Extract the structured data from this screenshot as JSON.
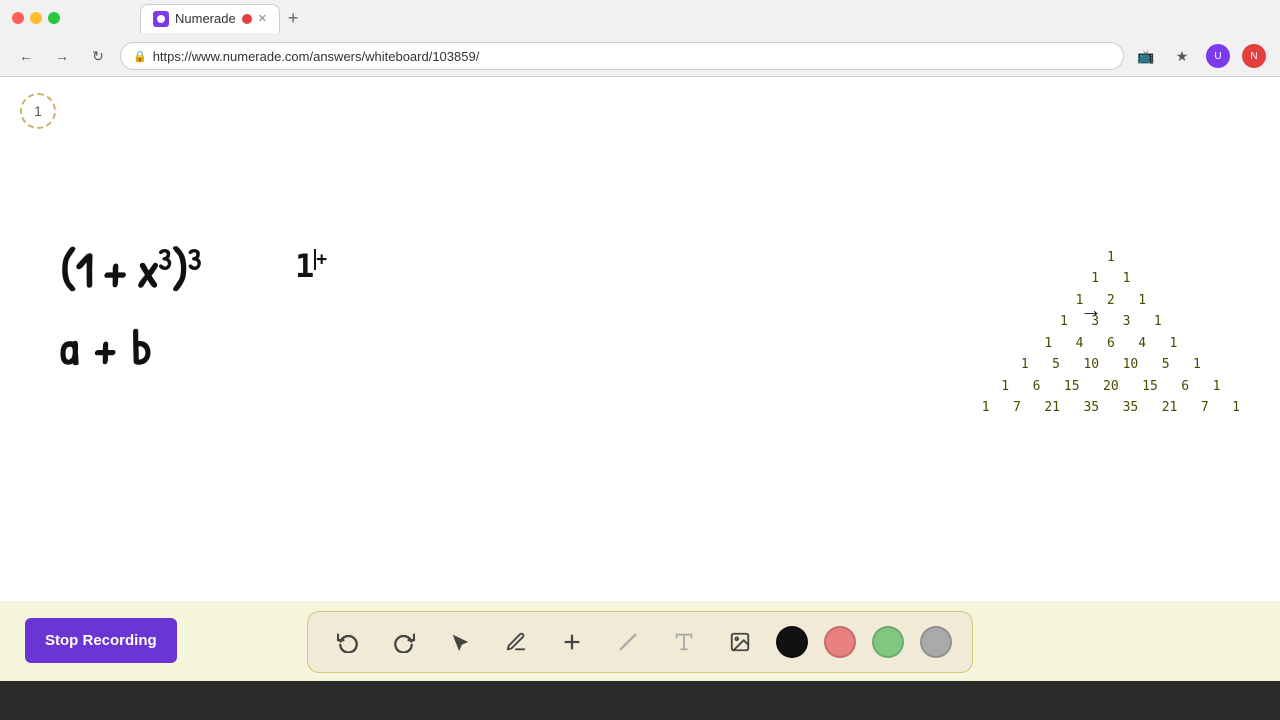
{
  "browser": {
    "traffic_lights": [
      "red",
      "yellow",
      "green"
    ],
    "tab": {
      "title": "Numerade",
      "url": "https://www.numerade.com/answers/whiteboard/103859/"
    },
    "nav_buttons": {
      "back": "←",
      "forward": "→",
      "refresh": "↻"
    }
  },
  "toolbar": {
    "stop_recording_label": "Stop Recording",
    "tools": [
      {
        "name": "undo",
        "icon": "↺"
      },
      {
        "name": "redo",
        "icon": "↻"
      },
      {
        "name": "select",
        "icon": "▲"
      },
      {
        "name": "pen",
        "icon": "✏"
      },
      {
        "name": "add",
        "icon": "+"
      },
      {
        "name": "eraser",
        "icon": "/"
      },
      {
        "name": "text",
        "icon": "A"
      },
      {
        "name": "image",
        "icon": "🖼"
      }
    ],
    "colors": [
      {
        "name": "black",
        "hex": "#111111"
      },
      {
        "name": "pink",
        "hex": "#e88080"
      },
      {
        "name": "green",
        "hex": "#80c880"
      },
      {
        "name": "gray",
        "hex": "#aaaaaa"
      }
    ]
  },
  "whiteboard": {
    "page_number": "1",
    "math_expression_line1": "(1 + x³)³",
    "math_expression_line2": "a + b",
    "pascals_triangle": [
      "1",
      "1   1",
      "1   2   1",
      "1   3   3   1",
      "1   4   6   4   1",
      "1   5   10   10   5   1",
      "1   6   15   20   15   6   1",
      "1   7   21   35   35   21   7   1"
    ]
  },
  "colors": {
    "stop_recording_bg": "#6b35d4",
    "toolbar_bg": "#f0ead6",
    "pascal_text": "#4a4a00",
    "whiteboard_bg": "#ffffff"
  }
}
